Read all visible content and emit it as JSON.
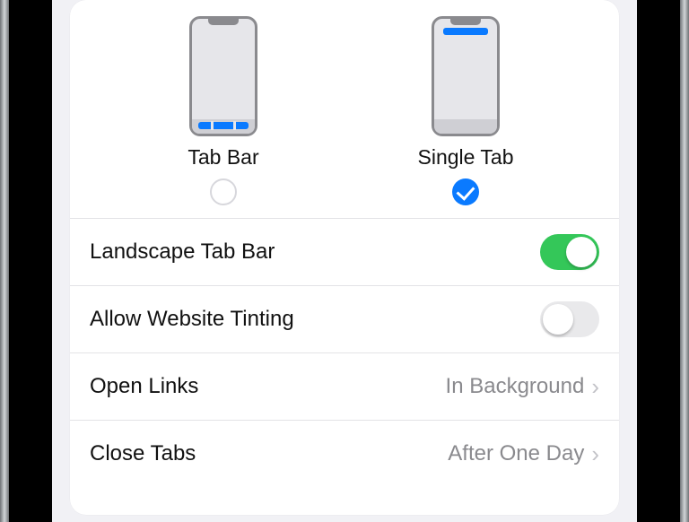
{
  "layout_options": {
    "tab_bar": {
      "label": "Tab Bar",
      "selected": false
    },
    "single_tab": {
      "label": "Single Tab",
      "selected": true
    }
  },
  "rows": {
    "landscape_tab_bar": {
      "label": "Landscape Tab Bar",
      "toggle_on": true
    },
    "allow_website_tint": {
      "label": "Allow Website Tinting",
      "toggle_on": false
    },
    "open_links": {
      "label": "Open Links",
      "value": "In Background"
    },
    "close_tabs": {
      "label": "Close Tabs",
      "value": "After One Day"
    }
  },
  "colors": {
    "accent_blue": "#0a7aff",
    "accent_green": "#34c759",
    "secondary": "#8a8a8e"
  }
}
